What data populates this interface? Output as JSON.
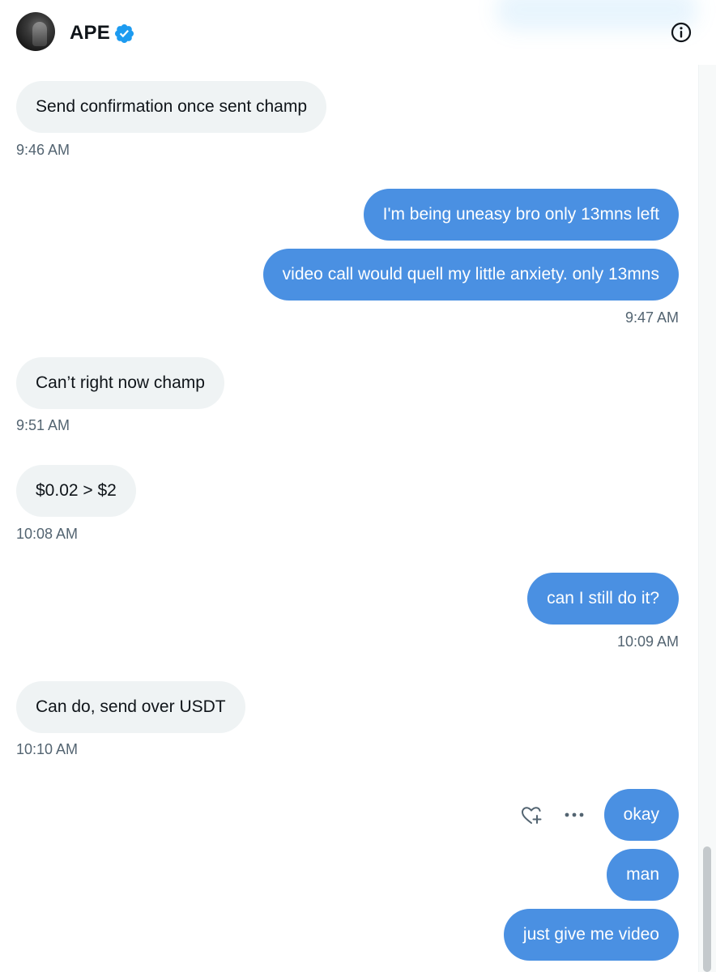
{
  "conversation": {
    "contact_name": "APE",
    "verified": true,
    "accent_color": "#4a90e2",
    "incoming_bg": "#eff3f4"
  },
  "messages": [
    {
      "direction": "in",
      "text": "Send confirmation once sent champ",
      "time": "9:46 AM"
    },
    {
      "direction": "out",
      "text": "I'm being uneasy bro only 13mns left"
    },
    {
      "direction": "out",
      "text": "video call would quell my little anxiety. only 13mns",
      "time": "9:47 AM"
    },
    {
      "direction": "in",
      "text": "Can’t right now champ",
      "time": "9:51 AM"
    },
    {
      "direction": "in",
      "text": "$0.02 > $2",
      "time": "10:08 AM"
    },
    {
      "direction": "out",
      "text": "can I still do it?",
      "time": "10:09 AM"
    },
    {
      "direction": "in",
      "text": "Can do, send over USDT",
      "time": "10:10 AM"
    },
    {
      "direction": "out",
      "text": "okay"
    },
    {
      "direction": "out",
      "text": "man"
    },
    {
      "direction": "out",
      "text": "just give me video"
    }
  ],
  "icons": {
    "info": "info-circle-icon",
    "verified": "verified-badge-icon",
    "react": "heart-plus-icon",
    "more": "more-dots-icon"
  }
}
